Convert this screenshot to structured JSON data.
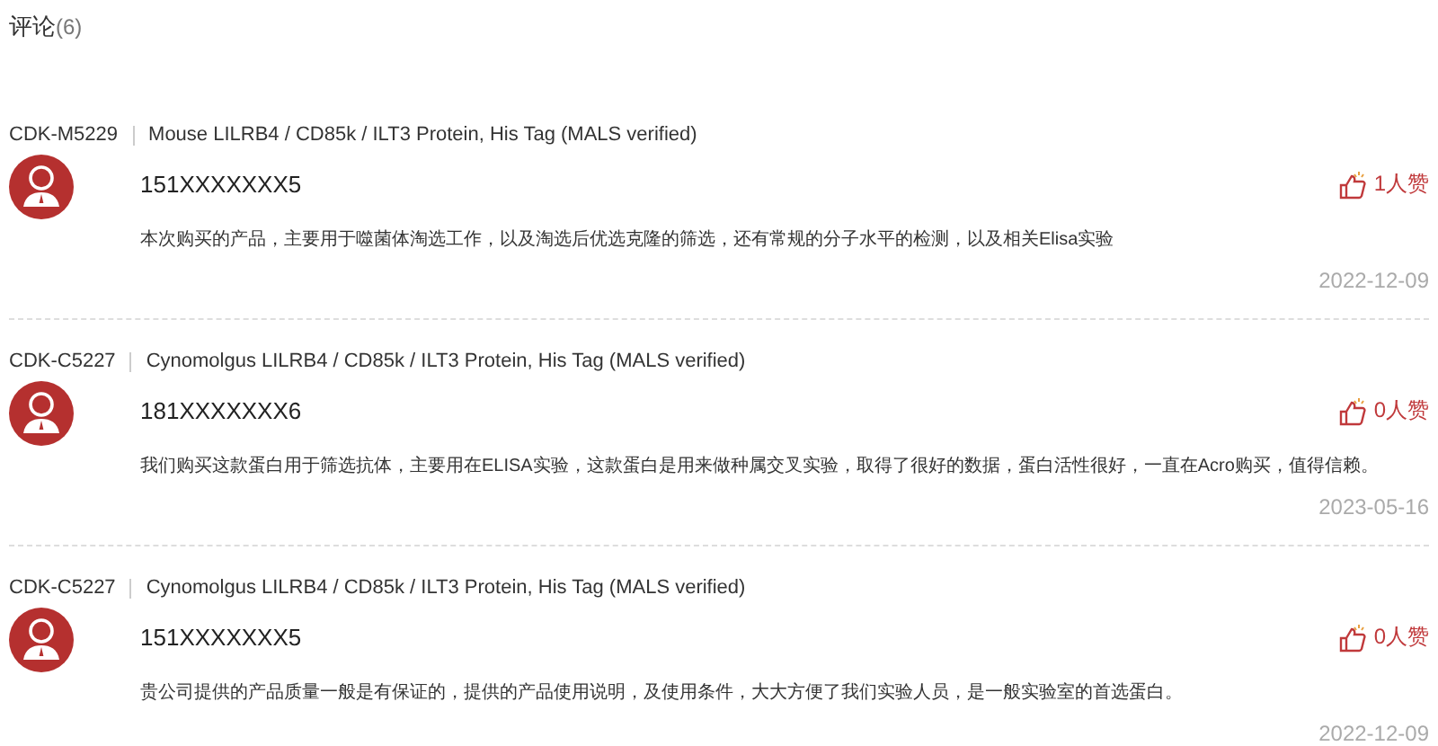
{
  "title": "评论",
  "count": "(6)",
  "comments": [
    {
      "product_code": "CDK-M5229",
      "product_name": "Mouse LILRB4 / CD85k / ILT3 Protein, His Tag (MALS verified)",
      "user": "151XXXXXXX5",
      "likes": "1人赞",
      "text": "本次购买的产品，主要用于噬菌体淘选工作，以及淘选后优选克隆的筛选，还有常规的分子水平的检测，以及相关Elisa实验",
      "date": "2022-12-09"
    },
    {
      "product_code": "CDK-C5227",
      "product_name": "Cynomolgus LILRB4 / CD85k / ILT3 Protein, His Tag (MALS verified)",
      "user": "181XXXXXXX6",
      "likes": "0人赞",
      "text": "我们购买这款蛋白用于筛选抗体，主要用在ELISA实验，这款蛋白是用来做种属交叉实验，取得了很好的数据，蛋白活性很好，一直在Acro购买，值得信赖。",
      "date": "2023-05-16"
    },
    {
      "product_code": "CDK-C5227",
      "product_name": "Cynomolgus LILRB4 / CD85k / ILT3 Protein, His Tag (MALS verified)",
      "user": "151XXXXXXX5",
      "likes": "0人赞",
      "text": "贵公司提供的产品质量一般是有保证的，提供的产品使用说明，及使用条件，大大方便了我们实验人员，是一般实验室的首选蛋白。",
      "date": "2022-12-09"
    }
  ]
}
